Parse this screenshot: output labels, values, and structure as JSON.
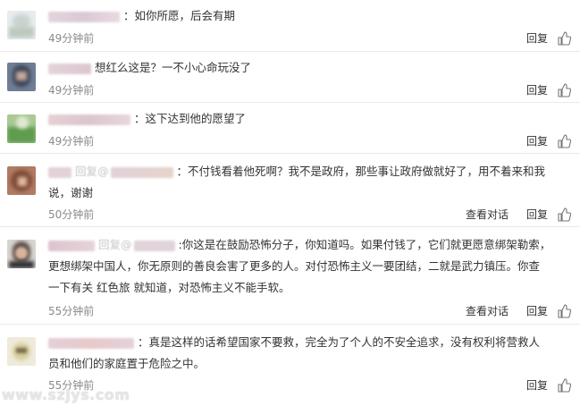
{
  "comments": [
    {
      "text": "：如你所愿，后会有期",
      "time": "49分钟前",
      "see_thread": "",
      "reply": "回复"
    },
    {
      "text": "想红么这是？一不小心命玩没了",
      "time": "49分钟前",
      "see_thread": "",
      "reply": "回复"
    },
    {
      "text": "：这下达到他的愿望了",
      "time": "49分钟前",
      "see_thread": "",
      "reply": "回复"
    },
    {
      "reply_prefix": "回复@",
      "text_line1": "：不付钱看着他死啊？我不是政府，那些事让政府做就好了，用不着来和我",
      "text_line2": "说，谢谢",
      "time": "50分钟前",
      "see_thread": "查看对话",
      "reply": "回复"
    },
    {
      "reply_prefix": "回复@",
      "text_line1": ":你这是在鼓励恐怖分子，你知道吗。如果付钱了，它们就更愿意绑架勒索，",
      "text_line2": "更想绑架中国人，你无原则的善良会害了更多的人。对付恐怖主义一要团结，二就是武力镇压。你查",
      "text_line3": "一下有关 红色旅 就知道，对恐怖主义不能手软。",
      "time": "55分钟前",
      "see_thread": "查看对话",
      "reply": "回复"
    },
    {
      "text_line1": "：真是这样的话希望国家不要救，完全为了个人的不安全追求，没有权利将营救人",
      "text_line2": "员和他们的家庭置于危险之中。",
      "time": "55分钟前",
      "see_thread": "",
      "reply": "回复"
    }
  ],
  "watermark": "www.szjys.com",
  "icons": {
    "like": "thumbs-up-icon"
  },
  "colors": {
    "text": "#333333",
    "time": "#8a8a8a",
    "divider": "#e9e9e9"
  }
}
